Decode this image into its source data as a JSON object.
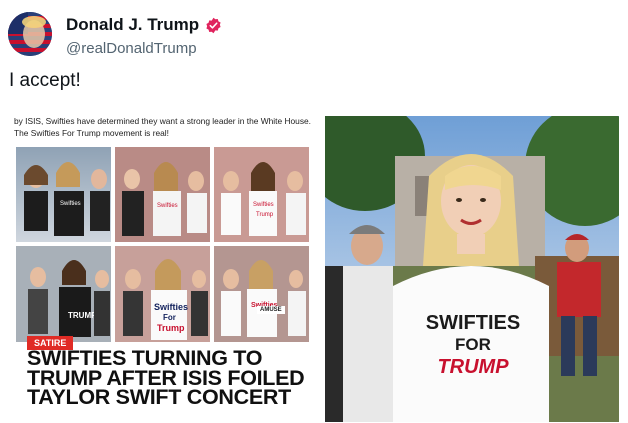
{
  "post": {
    "author_name": "Donald J. Trump",
    "author_handle": "@realDonaldTrump",
    "text": "I accept!"
  },
  "left_image": {
    "caption": "by ISIS, Swifties have determined they want a strong leader in the White House. The Swifties For Trump movement is real!",
    "shirt_text": [
      "Swifties",
      "For",
      "Trump"
    ],
    "shirt_text_big": [
      "SWIFTIES",
      "FOR",
      "TRUMP"
    ],
    "satire_badge": "SATIRE",
    "headline": "SWIFTIES TURNING TO TRUMP AFTER ISIS FOILED TAYLOR SWIFT CONCERT",
    "watermark": "AMUSE"
  },
  "right_image": {
    "shirt_line1": "SWIFTIES",
    "shirt_line2": "FOR",
    "shirt_line3": "TRUMP"
  },
  "colors": {
    "accent": "#e02b25",
    "verified": "#e0245e"
  },
  "icons": {
    "verified": "verified-badge-icon"
  }
}
